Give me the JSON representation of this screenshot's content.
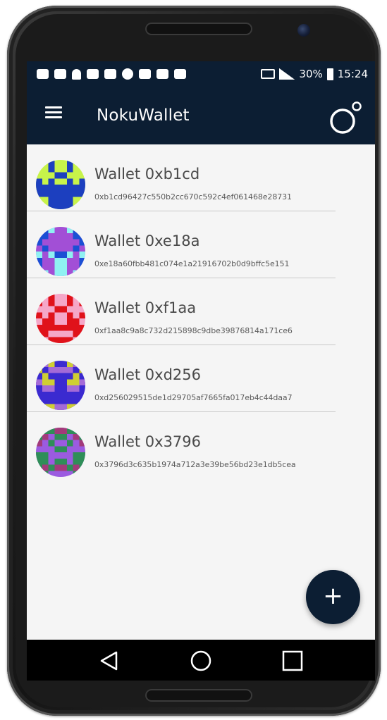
{
  "status_bar": {
    "battery": "30%",
    "time": "15:24"
  },
  "app_bar": {
    "title": "NokuWallet"
  },
  "wallets": [
    {
      "name": "Wallet 0xb1cd",
      "address": "0xb1cd96427c550b2cc670c592c4ef061468e28731",
      "avatar_colors": [
        "#c7f34a",
        "#1c3fbf"
      ]
    },
    {
      "name": "Wallet 0xe18a",
      "address": "0xe18a60fbb481c074e1a21916702b0d9bffc5e151",
      "avatar_colors": [
        "#a24fd6",
        "#8ff1f2",
        "#1b4fd4"
      ]
    },
    {
      "name": "Wallet 0xf1aa",
      "address": "0xf1aa8c9a8c732d215898c9dbe39876814a171ce6",
      "avatar_colors": [
        "#f5a7c8",
        "#e0121a"
      ]
    },
    {
      "name": "Wallet 0xd256",
      "address": "0xd256029515de1d29705af7665fa017eb4c44daa7",
      "avatar_colors": [
        "#3b2ad0",
        "#a46ad7",
        "#cfcf33"
      ]
    },
    {
      "name": "Wallet 0x3796",
      "address": "0x3796d3c635b1974a712a3e39be56bd23e1db5cea",
      "avatar_colors": [
        "#9b5be0",
        "#2f8e58",
        "#a23a7a"
      ]
    }
  ],
  "fab": {
    "label": "+"
  },
  "colors": {
    "primary": "#0c1e33",
    "background": "#f5f5f5",
    "text": "#4a4a4a"
  }
}
